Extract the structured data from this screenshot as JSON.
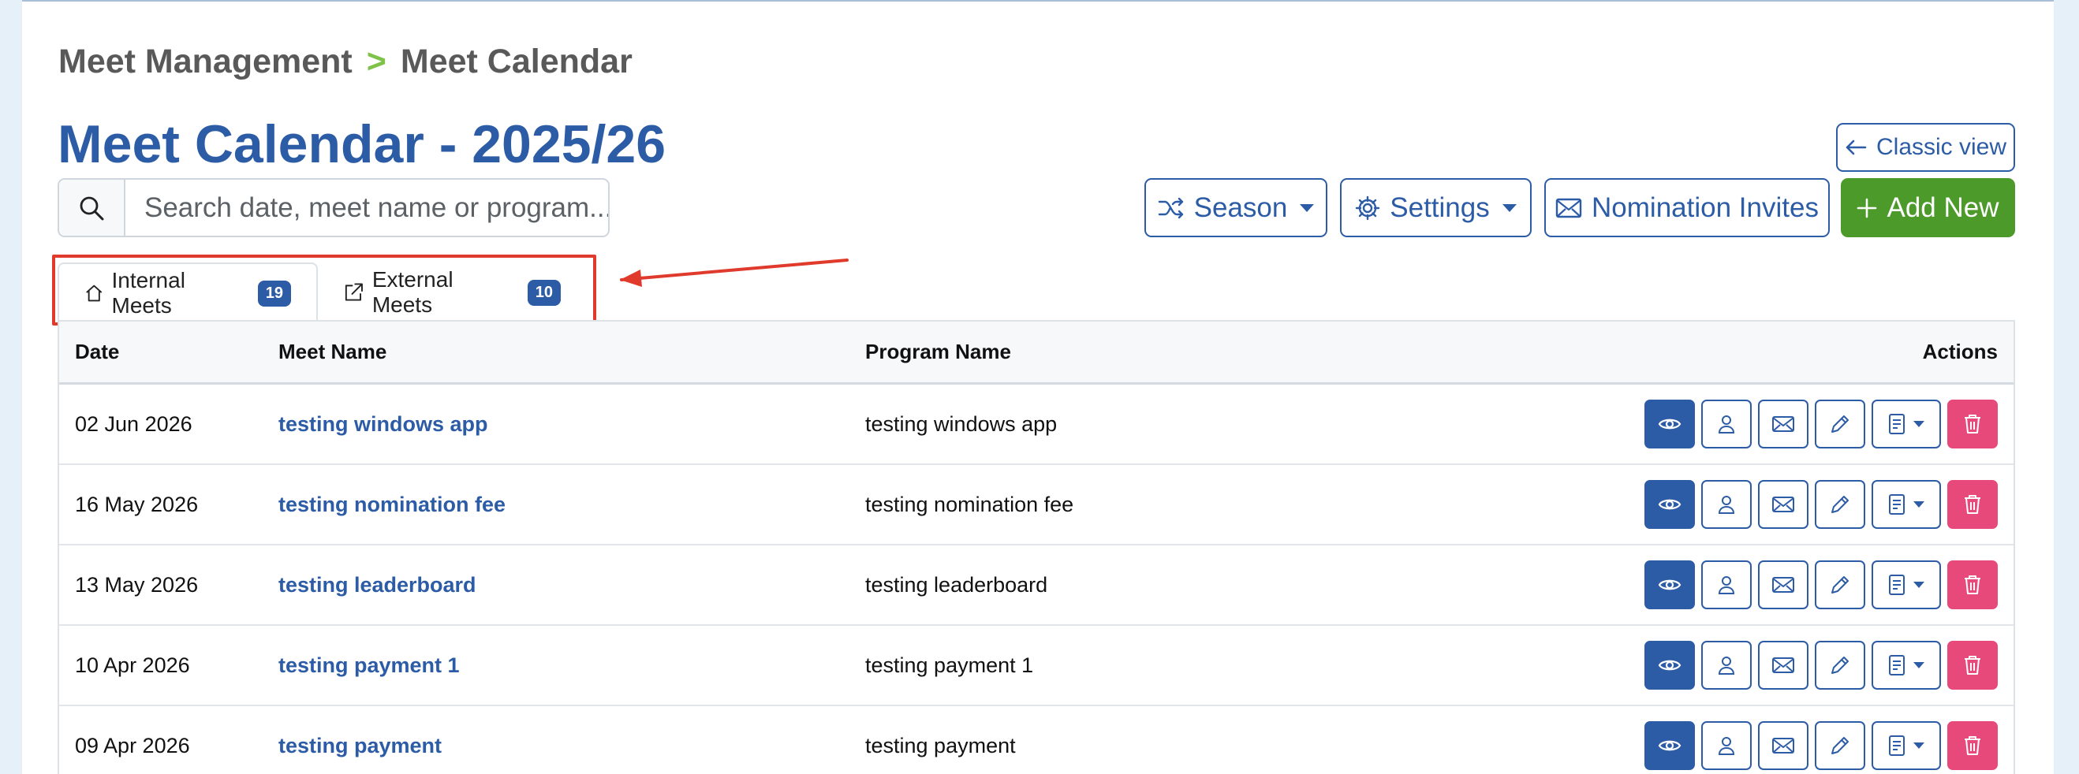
{
  "breadcrumb": {
    "parent": "Meet Management",
    "separator": ">",
    "current": "Meet Calendar"
  },
  "page": {
    "title": "Meet Calendar - 2025/26"
  },
  "search": {
    "placeholder": "Search date, meet name or program..."
  },
  "buttons": {
    "classic_view": "Classic view",
    "season": "Season",
    "settings": "Settings",
    "nomination_invites": "Nomination Invites",
    "add_new": "Add New"
  },
  "tabs": [
    {
      "label": "Internal Meets",
      "count": "19",
      "icon": "home-icon",
      "active": true
    },
    {
      "label": "External Meets",
      "count": "10",
      "icon": "external-link-icon",
      "active": false
    }
  ],
  "table": {
    "headers": {
      "date": "Date",
      "meet": "Meet Name",
      "program": "Program Name",
      "actions": "Actions"
    },
    "rows": [
      {
        "date": "02 Jun 2026",
        "meet": "testing windows app",
        "program": "testing windows app"
      },
      {
        "date": "16 May 2026",
        "meet": "testing nomination fee",
        "program": "testing nomination fee"
      },
      {
        "date": "13 May 2026",
        "meet": "testing leaderboard",
        "program": "testing leaderboard"
      },
      {
        "date": "10 Apr 2026",
        "meet": "testing payment 1",
        "program": "testing payment 1"
      },
      {
        "date": "09 Apr 2026",
        "meet": "testing payment",
        "program": "testing payment"
      }
    ]
  },
  "colors": {
    "primary": "#2d5ca6",
    "success": "#4c9a2a",
    "danger": "#e8497b",
    "highlight": "#e03a2c"
  }
}
